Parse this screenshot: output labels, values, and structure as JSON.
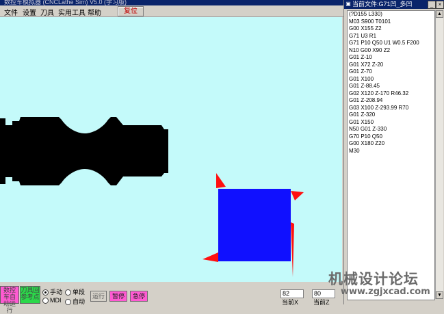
{
  "main_window": {
    "title": "数控车模拟器 (CNCLathe Sim) V5.0 (学习版)"
  },
  "menu": {
    "items": [
      "文件",
      "设置",
      "刀具",
      "实用工具",
      "帮助"
    ],
    "reset_label": "复位"
  },
  "controls": {
    "auto_run_label": "数控车自动运行",
    "tool_ref_label": "刀具回参考点",
    "mode_options": [
      {
        "label": "手动",
        "selected": true
      },
      {
        "label": "单段",
        "selected": false
      },
      {
        "label": "MDI",
        "selected": false
      },
      {
        "label": "自动",
        "selected": false
      }
    ],
    "run_label": "运行",
    "pause_label": "暂停",
    "estop_label": "急停",
    "coord_x_value": "82",
    "coord_x_label": "当前X",
    "coord_z_value": "80",
    "coord_z_label": "当前Z"
  },
  "program_window": {
    "title": "当前文件:G71凹_多凹",
    "lines": [
      "(?D155 L330)",
      "M03 S900 T0101",
      "G00 X155 Z2",
      "G71 U3 R1",
      "G71 P10 Q50 U1 W0.5 F200",
      "N10 G00 X90 Z2",
      "G01 Z-10",
      "G01 X72 Z-20",
      "G01 Z-70",
      "G01 X100",
      "G01 Z-88.45",
      "G02 X120 Z-170 R46.32",
      "G01 Z-208.94",
      "G03 X100 Z-293.99 R70",
      "G01 Z-320",
      "G01 X150",
      "N50 G01 Z-330",
      "G70 P10 Q50",
      "G00 X180 Z20",
      "M30"
    ]
  },
  "watermark": {
    "title": "机械设计论坛",
    "url": "www.zgjxcad.com"
  },
  "colors": {
    "canvas_bg": "#c4fafa",
    "workpiece": "#000000",
    "tool_holder": "#1010ff",
    "tool_insert": "#ff1010",
    "title_bar": "#0a246a"
  }
}
